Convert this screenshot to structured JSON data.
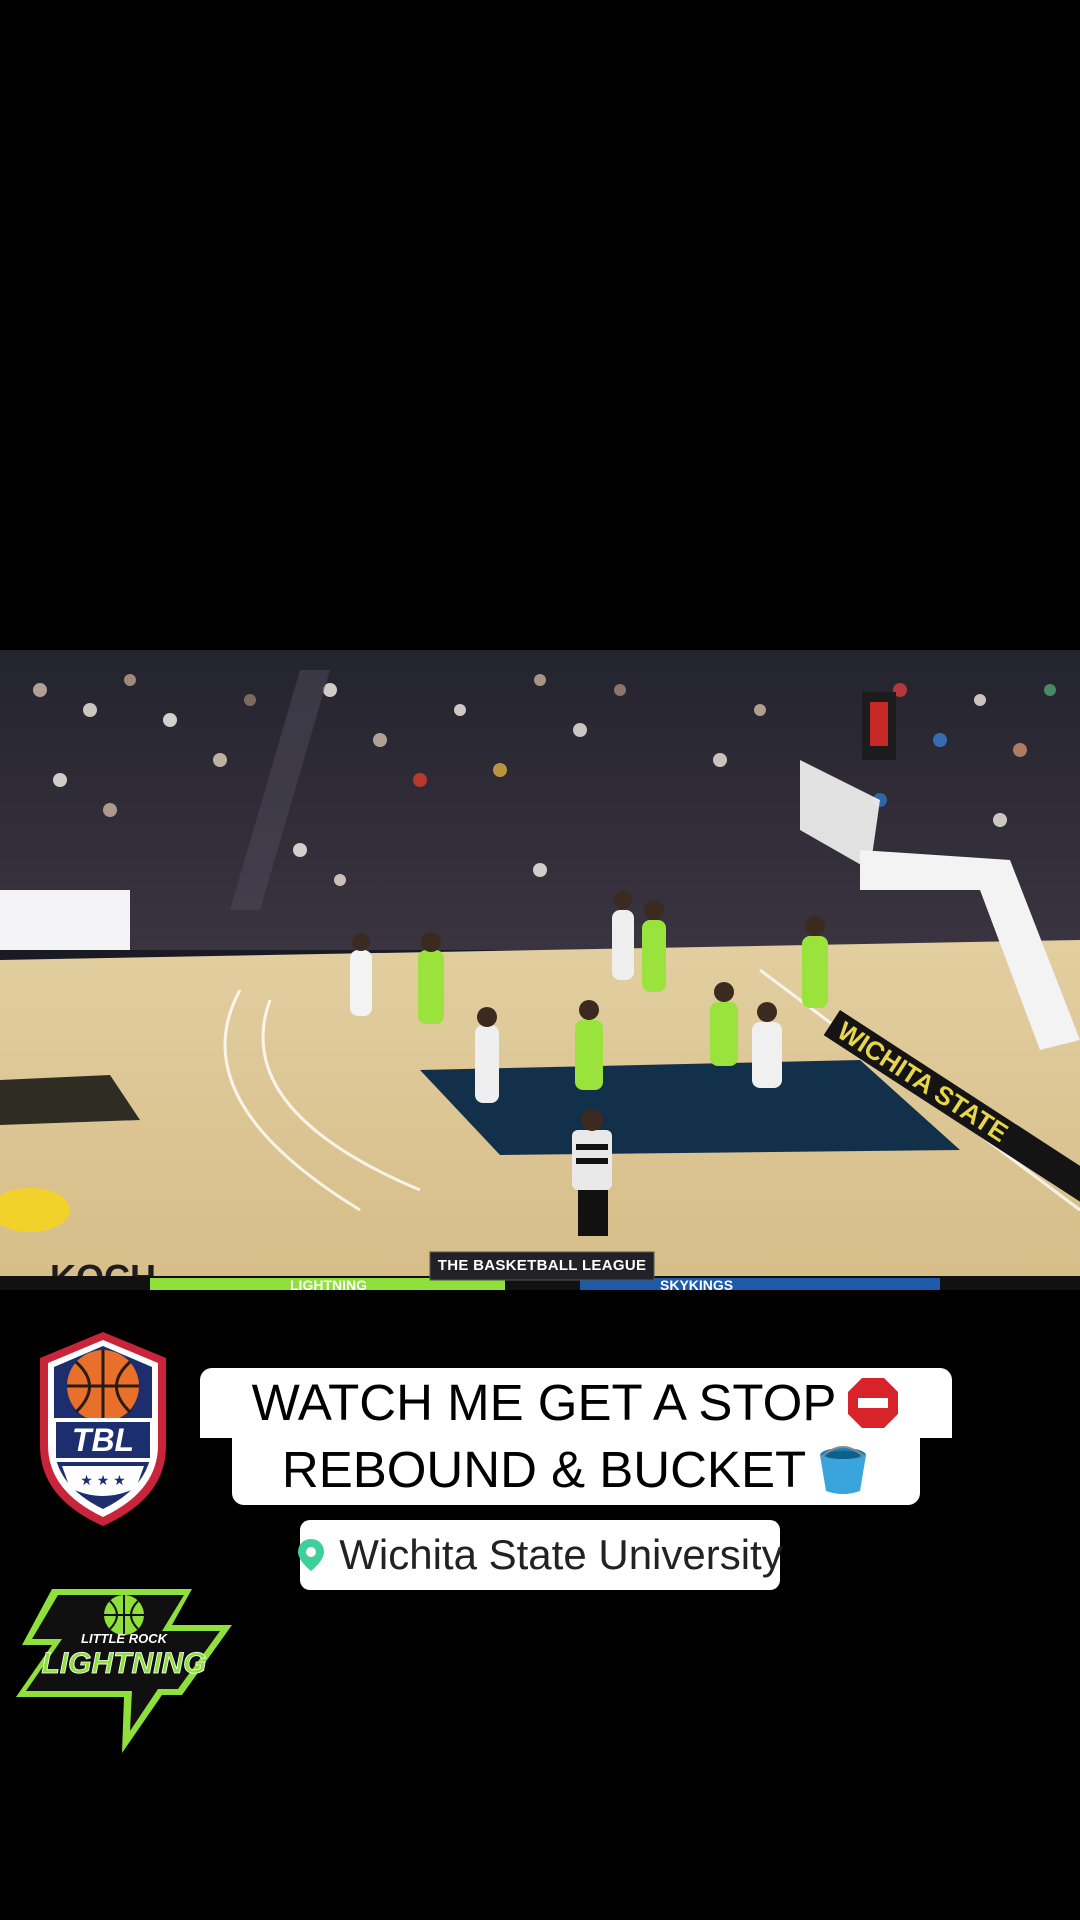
{
  "video": {
    "broadcast_banner": "THE BASKETBALL LEAGUE",
    "sideline_text": "WICHITA STATE",
    "baseline_text": "KOCH",
    "scorebug_home": "LIGHTNING",
    "scorebug_away": "SKYKINGS"
  },
  "caption": {
    "line1": "WATCH ME GET A STOP",
    "line2": "REBOUND & BUCKET",
    "line1_emoji": "stop-sign-icon",
    "line2_emoji": "bucket-icon"
  },
  "location": {
    "name": "Wichita State University",
    "icon": "location-pin-icon",
    "pin_color": "#3ecf9a"
  },
  "logos": {
    "league": {
      "name": "TBL",
      "icon": "tbl-shield-logo"
    },
    "team": {
      "name_top": "LITTLE ROCK",
      "name": "LIGHTNING",
      "icon": "lightning-team-logo"
    }
  },
  "colors": {
    "background": "#000000",
    "caption_bg": "#ffffff",
    "team_green": "#8fe03a",
    "tbl_navy": "#1c2e6e",
    "tbl_red": "#c8243a"
  }
}
